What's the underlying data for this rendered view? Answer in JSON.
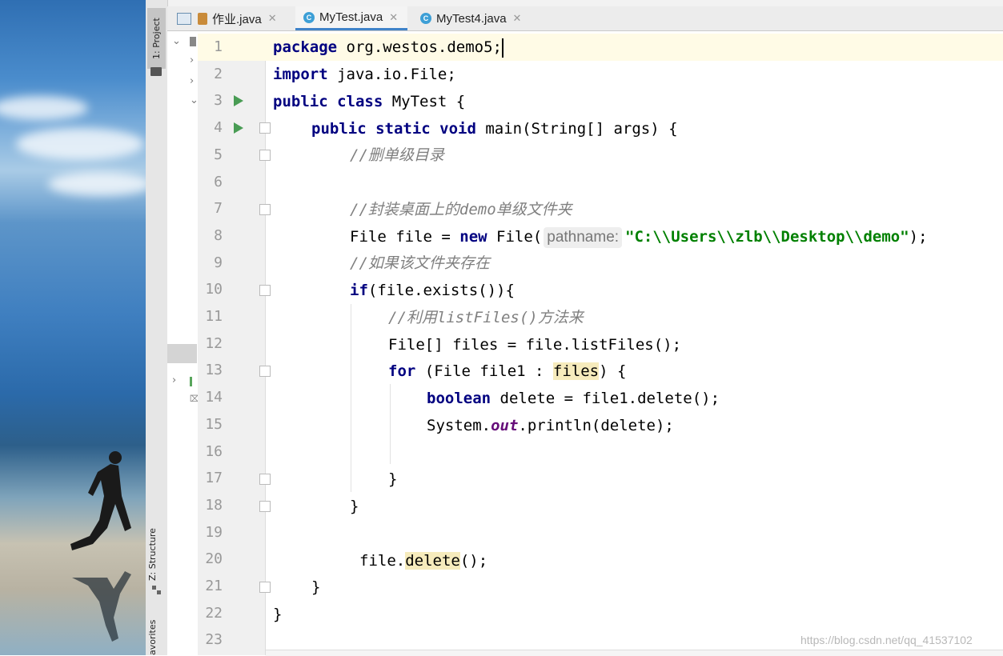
{
  "window": {
    "tool_tabs": {
      "project": "1: Project",
      "structure": "Z: Structure",
      "favorites": "avorites"
    }
  },
  "tabs": [
    {
      "label": "作业.java",
      "active": false,
      "icon": "java-file-icon"
    },
    {
      "label": "MyTest.java",
      "active": true,
      "icon": "class-icon"
    },
    {
      "label": "MyTest4.java",
      "active": false,
      "icon": "class-icon"
    }
  ],
  "editor": {
    "line_numbers": [
      "1",
      "2",
      "3",
      "4",
      "5",
      "6",
      "7",
      "8",
      "9",
      "10",
      "11",
      "12",
      "13",
      "14",
      "15",
      "16",
      "17",
      "18",
      "19",
      "20",
      "21",
      "22",
      "23"
    ],
    "current_line": 1,
    "lines": {
      "l1": {
        "kw": "package",
        "rest": " org.westos.demo5;"
      },
      "l2": {
        "kw": "import",
        "rest": " java.io.File;"
      },
      "l3": {
        "kw": "public class",
        "rest": " MyTest {"
      },
      "l4": {
        "kw": "public static void",
        "rest": " main(String[] args) {"
      },
      "l5": {
        "comment": "//删单级目录"
      },
      "l7": {
        "comment": "//封装桌面上的demo单级文件夹"
      },
      "l8": {
        "pre": "File file = ",
        "kw": "new",
        "mid": " File(",
        "hint": "pathname:",
        "str": "\"C:\\\\Users\\\\zlb\\\\Desktop\\\\demo\"",
        "post": ");"
      },
      "l9": {
        "comment": "//如果该文件夹存在"
      },
      "l10": {
        "kw": "if",
        "rest": "(file.exists()){"
      },
      "l11": {
        "comment": "//利用listFiles()方法来"
      },
      "l12": {
        "rest": "File[] files = file.listFiles();"
      },
      "l13": {
        "kw": "for",
        "pre": " (File file1 : ",
        "usage": "files",
        "post": ") {"
      },
      "l14": {
        "kw": "boolean",
        "rest": " delete = file1.delete();"
      },
      "l15": {
        "pre": "System.",
        "field": "out",
        "post": ".println(delete);"
      },
      "l17": {
        "rest": "}"
      },
      "l18": {
        "rest": "}"
      },
      "l20": {
        "pre": "file.",
        "usage": "delete",
        "post": "();"
      },
      "l21": {
        "rest": "}"
      },
      "l22": {
        "rest": "}"
      }
    }
  },
  "watermark": "https://blog.csdn.net/qq_41537102",
  "colors": {
    "keyword": "#000080",
    "string": "#008000",
    "comment": "#808080",
    "tab_accent": "#4083c9",
    "run_icon": "#499c54"
  }
}
